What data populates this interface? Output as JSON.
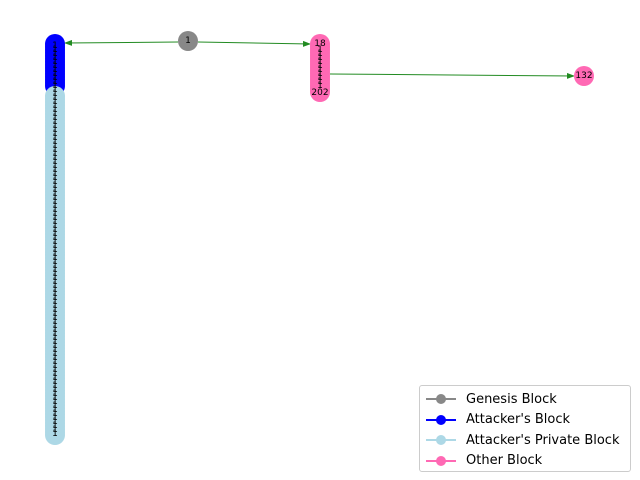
{
  "nodes": {
    "genesis": {
      "label": "1",
      "color": "#888888"
    },
    "other_top": {
      "label": "18",
      "color": "#ff69b4"
    },
    "other_bottom": {
      "label": "202",
      "color": "#ff69b4"
    },
    "other_far": {
      "label": "132",
      "color": "#ff69b4"
    },
    "attacker_color": "#0000ff",
    "private_color": "#add8e6"
  },
  "edge_color": "#228b22",
  "legend": [
    {
      "label": "Genesis Block",
      "color": "#888888"
    },
    {
      "label": "Attacker's Block",
      "color": "#0000ff"
    },
    {
      "label": "Attacker's Private Block",
      "color": "#add8e6"
    },
    {
      "label": "Other Block",
      "color": "#ff69b4"
    }
  ]
}
